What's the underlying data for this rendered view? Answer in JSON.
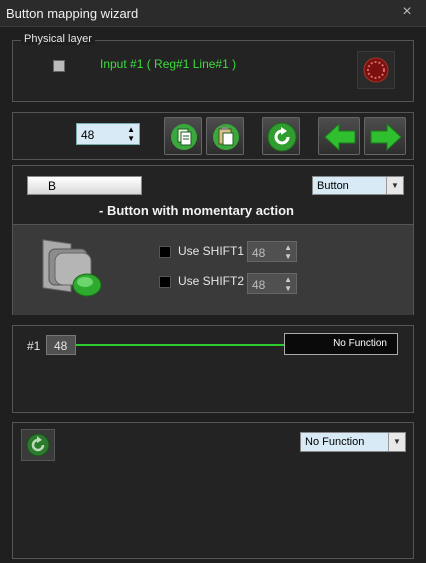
{
  "window": {
    "title": "Button mapping wizard",
    "close_glyph": "×"
  },
  "physical_layer": {
    "legend": "Physical layer",
    "input_label": "Input #1  ( Reg#1   Line#1 )"
  },
  "toolbar": {
    "value": "48"
  },
  "button_config": {
    "name": "B",
    "type_selected": "Button",
    "description": "- Button with momentary action",
    "shift1_label": "Use SHIFT1",
    "shift1_value": "48",
    "shift2_label": "Use SHIFT2",
    "shift2_value": "48"
  },
  "mapping": {
    "index": "#1",
    "value": "48",
    "function": "No Function"
  },
  "action": {
    "function_selected": "No Function"
  },
  "colors": {
    "accent_green": "#3ddc3d",
    "field_bg": "#d8eaf6"
  }
}
